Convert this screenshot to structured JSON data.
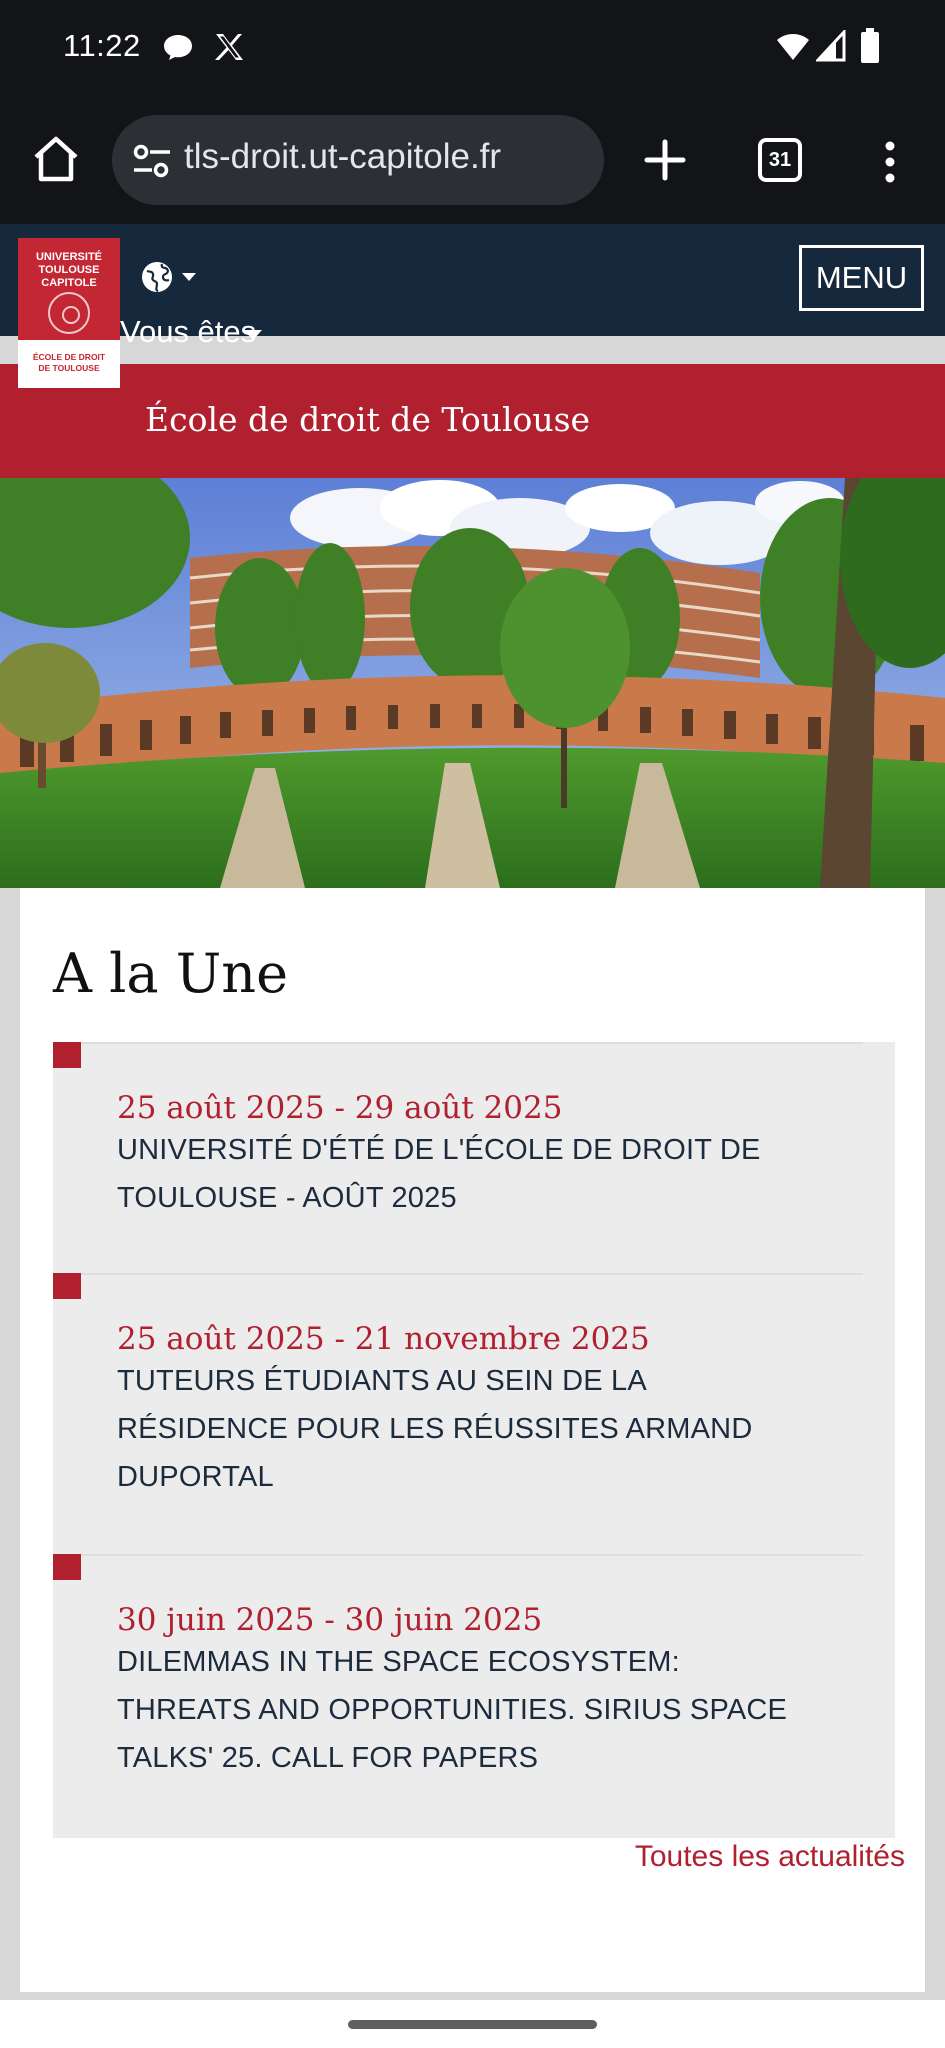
{
  "status_bar": {
    "time": "11:22",
    "icons": [
      "chat-bubble-icon",
      "x-logo-icon",
      "wifi-icon",
      "signal-icon",
      "battery-icon"
    ]
  },
  "browser": {
    "url": "tls-droit.ut-capitole.fr",
    "tab_count": "31",
    "icons": [
      "home-icon",
      "site-settings-icon",
      "new-tab-icon",
      "tabs-icon",
      "more-vert-icon"
    ]
  },
  "site_header": {
    "logo": {
      "line1": "UNIVERSITÉ",
      "line2": "TOULOUSE",
      "line3": "CAPITOLE",
      "bottom1": "ÉCOLE DE DROIT",
      "bottom2": "DE TOULOUSE"
    },
    "menu_label": "MENU",
    "audience_label": "Vous êtes",
    "background_color": "#16283b"
  },
  "banner": {
    "title": "École de droit de Toulouse",
    "color": "#b0202f"
  },
  "main": {
    "section_title": "A la Une",
    "news": [
      {
        "date": "25 août 2025 - 29 août 2025",
        "title_lines": [
          "UNIVERSITÉ D'ÉTÉ DE L'ÉCOLE DE DROIT DE",
          "TOULOUSE - AOÛT 2025"
        ]
      },
      {
        "date": "25 août 2025 - 21 novembre 2025",
        "title_lines": [
          "TUTEURS ÉTUDIANTS AU SEIN DE LA",
          "RÉSIDENCE POUR LES RÉUSSITES ARMAND",
          "DUPORTAL"
        ]
      },
      {
        "date": "30 juin 2025 - 30 juin 2025",
        "title_lines": [
          "DILEMMAS IN THE SPACE ECOSYSTEM:",
          "THREATS AND OPPORTUNITIES. SIRIUS SPACE",
          "TALKS' 25. CALL FOR PAPERS"
        ]
      }
    ],
    "all_news_label": "Toutes les actualités"
  }
}
